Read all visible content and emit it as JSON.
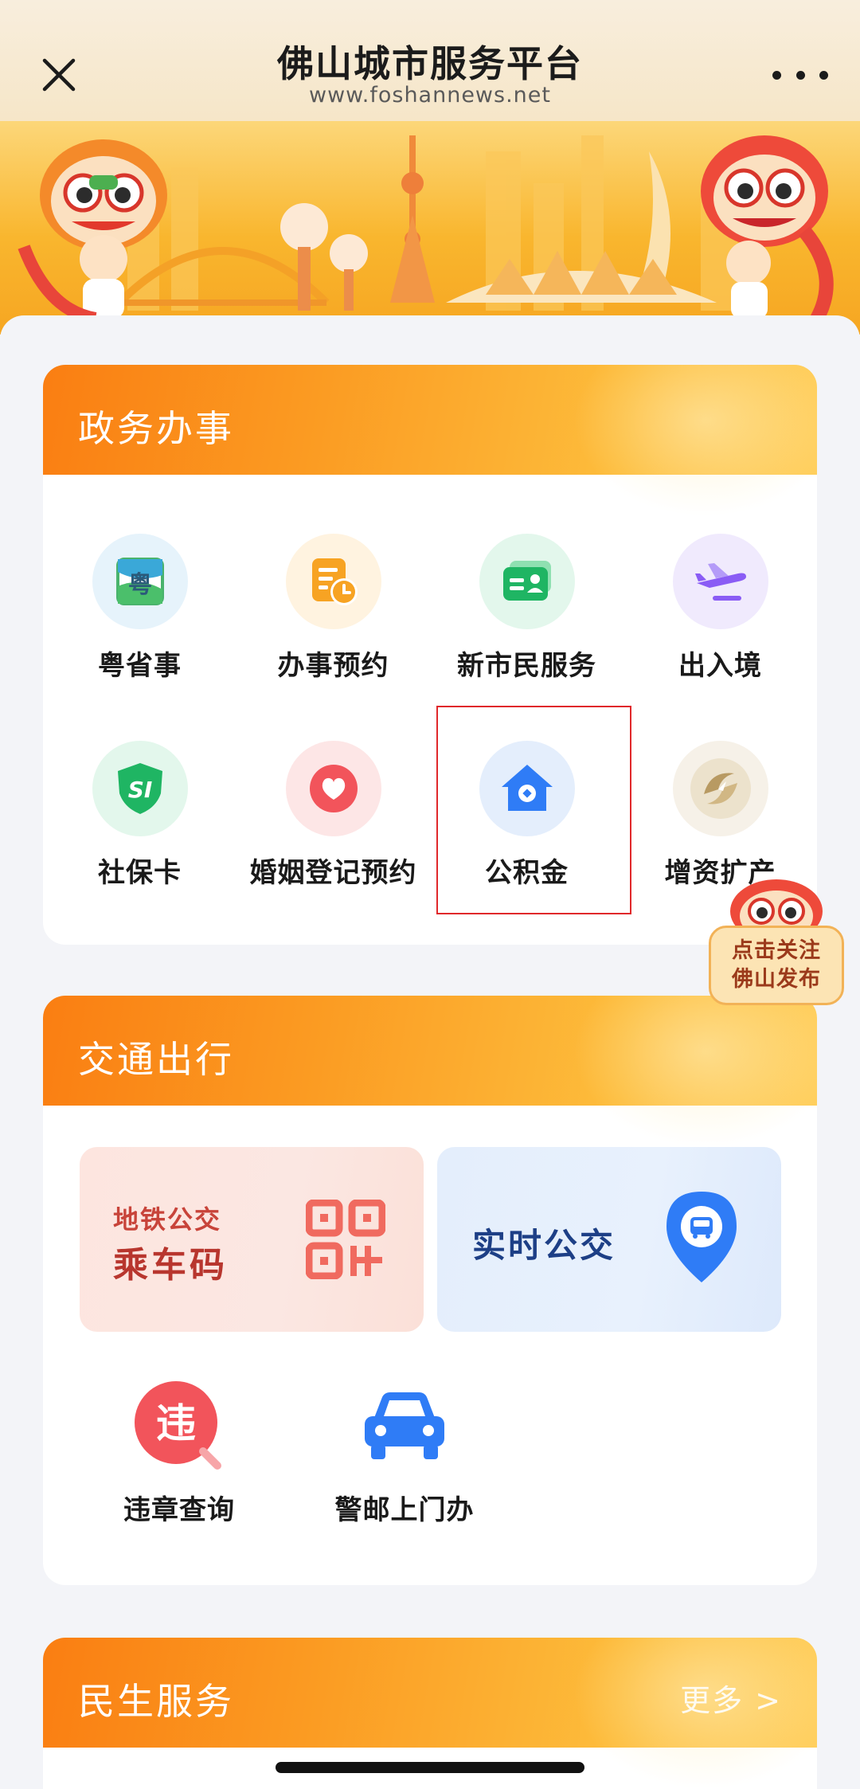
{
  "nav": {
    "title": "佛山城市服务平台",
    "subtitle": "www.foshannews.net"
  },
  "gov_section": {
    "title": "政务办事",
    "items": [
      {
        "label": "粤省事",
        "icon": "yue-sheng-shi-icon"
      },
      {
        "label": "办事预约",
        "icon": "appointment-icon"
      },
      {
        "label": "新市民服务",
        "icon": "id-card-icon"
      },
      {
        "label": "出入境",
        "icon": "airplane-icon"
      },
      {
        "label": "社保卡",
        "icon": "social-security-shield-icon"
      },
      {
        "label": "婚姻登记预约",
        "icon": "heart-icon"
      },
      {
        "label": "公积金",
        "icon": "house-icon"
      },
      {
        "label": "增资扩产",
        "icon": "growth-logo-icon"
      }
    ]
  },
  "follow_badge": {
    "line1": "点击关注",
    "line2": "佛山发布"
  },
  "transport_section": {
    "title": "交通出行",
    "metro_tile": {
      "sub": "地铁公交",
      "main": "乘车码",
      "icon": "qr-code-icon"
    },
    "bus_tile": {
      "label": "实时公交",
      "icon": "bus-location-icon"
    },
    "items": [
      {
        "label": "违章查询",
        "icon": "violation-icon"
      },
      {
        "label": "警邮上门办",
        "icon": "car-icon"
      }
    ]
  },
  "livelihood_section": {
    "title": "民生服务",
    "more": "更多 >"
  },
  "colors": {
    "accent_orange": "#fa7e12",
    "highlight_red": "#e0282b"
  }
}
